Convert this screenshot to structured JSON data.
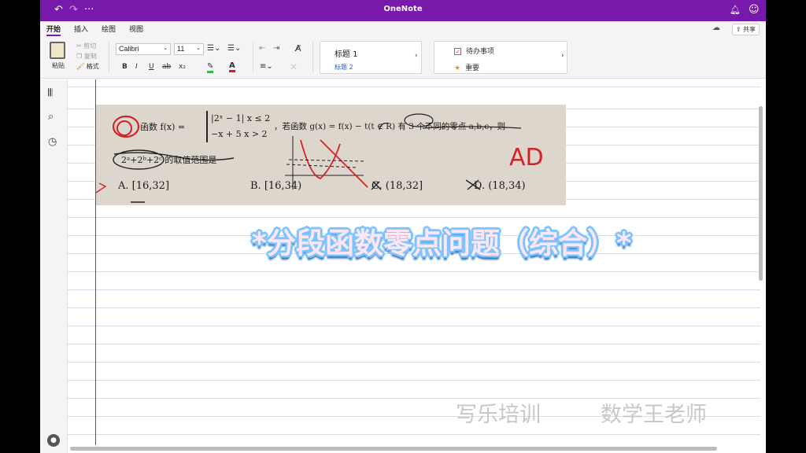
{
  "titlebar": {
    "title": "OneNote",
    "undo_icon": "undo-icon",
    "redo_icon": "redo-icon",
    "more": "···",
    "bell_icon": "bell-icon",
    "smiley_icon": "smiley-icon"
  },
  "tabs": [
    "开始",
    "插入",
    "绘图",
    "视图"
  ],
  "share_label": "共享",
  "ribbon": {
    "paste": "粘贴",
    "cut": "剪切",
    "copy": "复制",
    "format": "格式",
    "font": "Calibri",
    "size": "11",
    "bold": "B",
    "italic": "I",
    "underline": "U",
    "strike": "ab",
    "subscript": "x₂",
    "font_color": "A",
    "styles": [
      "标题 1",
      "标题 2"
    ],
    "tags": [
      "待办事项",
      "重要"
    ]
  },
  "problem": {
    "line1_pre": "函数 f(x) =",
    "piece1": "|2ˣ − 1|  x ≤ 2",
    "piece2": "−x + 5   x > 2",
    "line1_post": "，若函数 g(x) = f(x) − t(t ∈ R) 有 3 个不同的零点 a,b,c，则",
    "line2": "2ᵃ+2ᵇ+2ᶜ 的取值范围是",
    "options": [
      "A.  [16,32]",
      "B.  [16,34)",
      "C.  (18,32]",
      "D.  (18,34)"
    ],
    "handwritten": "AD"
  },
  "headline": "*分段函数零点问题（综合）*",
  "watermark": [
    "写乐培训",
    "数学王老师"
  ]
}
